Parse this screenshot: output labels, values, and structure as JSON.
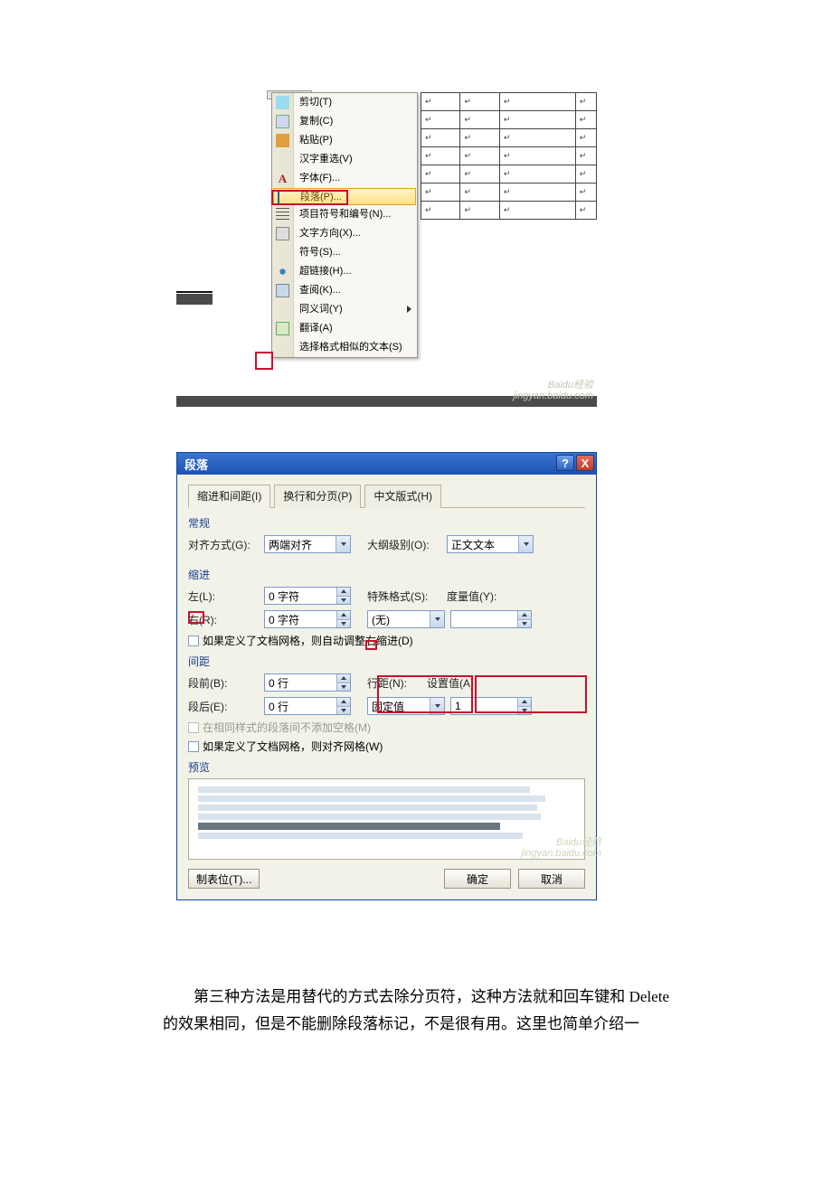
{
  "context_menu": {
    "items": [
      {
        "label": "剪切(T)",
        "icon": "cut-icon"
      },
      {
        "label": "复制(C)",
        "icon": "copy-icon"
      },
      {
        "label": "粘贴(P)",
        "icon": "paste-icon"
      },
      {
        "label": "汉字重选(V)",
        "icon": ""
      },
      {
        "label": "字体(F)...",
        "icon": "font-icon"
      },
      {
        "label": "段落(P)...",
        "icon": "paragraph-icon",
        "highlighted": true
      },
      {
        "label": "项目符号和编号(N)...",
        "icon": "bullets-icon"
      },
      {
        "label": "文字方向(X)...",
        "icon": "textdir-icon"
      },
      {
        "label": "符号(S)...",
        "icon": ""
      },
      {
        "label": "超链接(H)...",
        "icon": "hyperlink-icon"
      },
      {
        "label": "查阅(K)...",
        "icon": "review-icon"
      },
      {
        "label": "同义词(Y)",
        "icon": "",
        "submenu": true
      },
      {
        "label": "翻译(A)",
        "icon": "translate-icon"
      },
      {
        "label": "选择格式相似的文本(S)",
        "icon": ""
      }
    ]
  },
  "watermark1": {
    "line1": "Baidu经验",
    "line2": "jingyan.baidu.com"
  },
  "dialog": {
    "title": "段落",
    "help": "?",
    "close": "X",
    "tabs": {
      "indent_spacing": "缩进和间距(I)",
      "line_page": "换行和分页(P)",
      "chinese": "中文版式(H)"
    },
    "general": {
      "section": "常规",
      "alignment_label": "对齐方式(G):",
      "alignment_value": "两端对齐",
      "outline_label": "大纲级别(O):",
      "outline_value": "正文文本"
    },
    "indent": {
      "section": "缩进",
      "left_label": "左(L):",
      "left_value": "0 字符",
      "right_label": "右(R):",
      "right_value": "0 字符",
      "special_label": "特殊格式(S):",
      "special_value": "(无)",
      "measure_label": "度量值(Y):",
      "measure_value": "",
      "auto_check": "如果定义了文档网格，则自动调整右缩进(D)"
    },
    "spacing": {
      "section": "间距",
      "before_label": "段前(B):",
      "before_value": "0 行",
      "after_label": "段后(E):",
      "after_value": "0 行",
      "linespace_label": "行距(N):",
      "linespace_value": "固定值",
      "setat_label": "设置值(A):",
      "setat_value": "1",
      "no_space_same_style": "在相同样式的段落间不添加空格(M)",
      "snap_grid": "如果定义了文档网格，则对齐网格(W)"
    },
    "preview_label": "预览",
    "footer": {
      "tabs_btn": "制表位(T)...",
      "ok": "确定",
      "cancel": "取消"
    }
  },
  "watermark2": {
    "line1": "Baidu经验",
    "line2": "jingyan.baidu.com"
  },
  "article": {
    "p1": "第三种方法是用替代的方式去除分页符，这种方法就和回车键和 Delete 的效果相同，但是不能删除段落标记，不是很有用。这里也简单介绍一"
  }
}
